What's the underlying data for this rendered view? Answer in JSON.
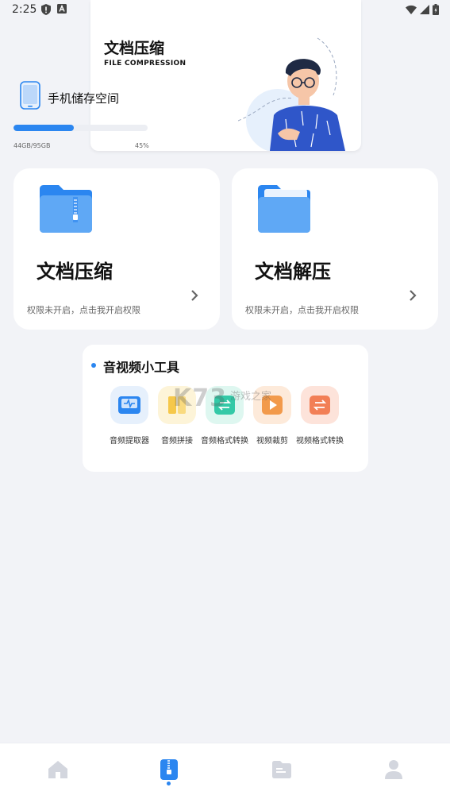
{
  "status_bar": {
    "time": "2:25"
  },
  "banner": {
    "title": "文档压缩",
    "subtitle": "FILE COMPRESSION"
  },
  "storage": {
    "label": "手机储存空间",
    "used_total": "44GB/95GB",
    "percent_text": "45%",
    "percent": 0.45
  },
  "cards": [
    {
      "title": "文档压缩",
      "desc": "权限未开启，点击我开启权限"
    },
    {
      "title": "文档解压",
      "desc": "权限未开启，点击我开启权限"
    }
  ],
  "tools": {
    "title": "音视频小工具",
    "items": [
      {
        "label": "音频提取器",
        "icon": "audio-extract-icon",
        "color": "#2b86f0"
      },
      {
        "label": "音频拼接",
        "icon": "audio-join-icon",
        "color": "#f6c84a"
      },
      {
        "label": "音频格式转换",
        "icon": "audio-convert-icon",
        "color": "#34c9a7"
      },
      {
        "label": "视频裁剪",
        "icon": "video-crop-icon",
        "color": "#f29a4b"
      },
      {
        "label": "视频格式转换",
        "icon": "video-convert-icon",
        "color": "#f27f56"
      }
    ]
  },
  "watermark": {
    "main": "K73",
    "sub": "游戏之家"
  },
  "bottom_nav": [
    {
      "icon": "home-icon",
      "active": false
    },
    {
      "icon": "document-zip-icon",
      "active": true
    },
    {
      "icon": "file-manager-icon",
      "active": false
    },
    {
      "icon": "profile-icon",
      "active": false
    }
  ],
  "colors": {
    "accent": "#2b86f0",
    "background": "#f2f3f7",
    "card": "#ffffff"
  }
}
